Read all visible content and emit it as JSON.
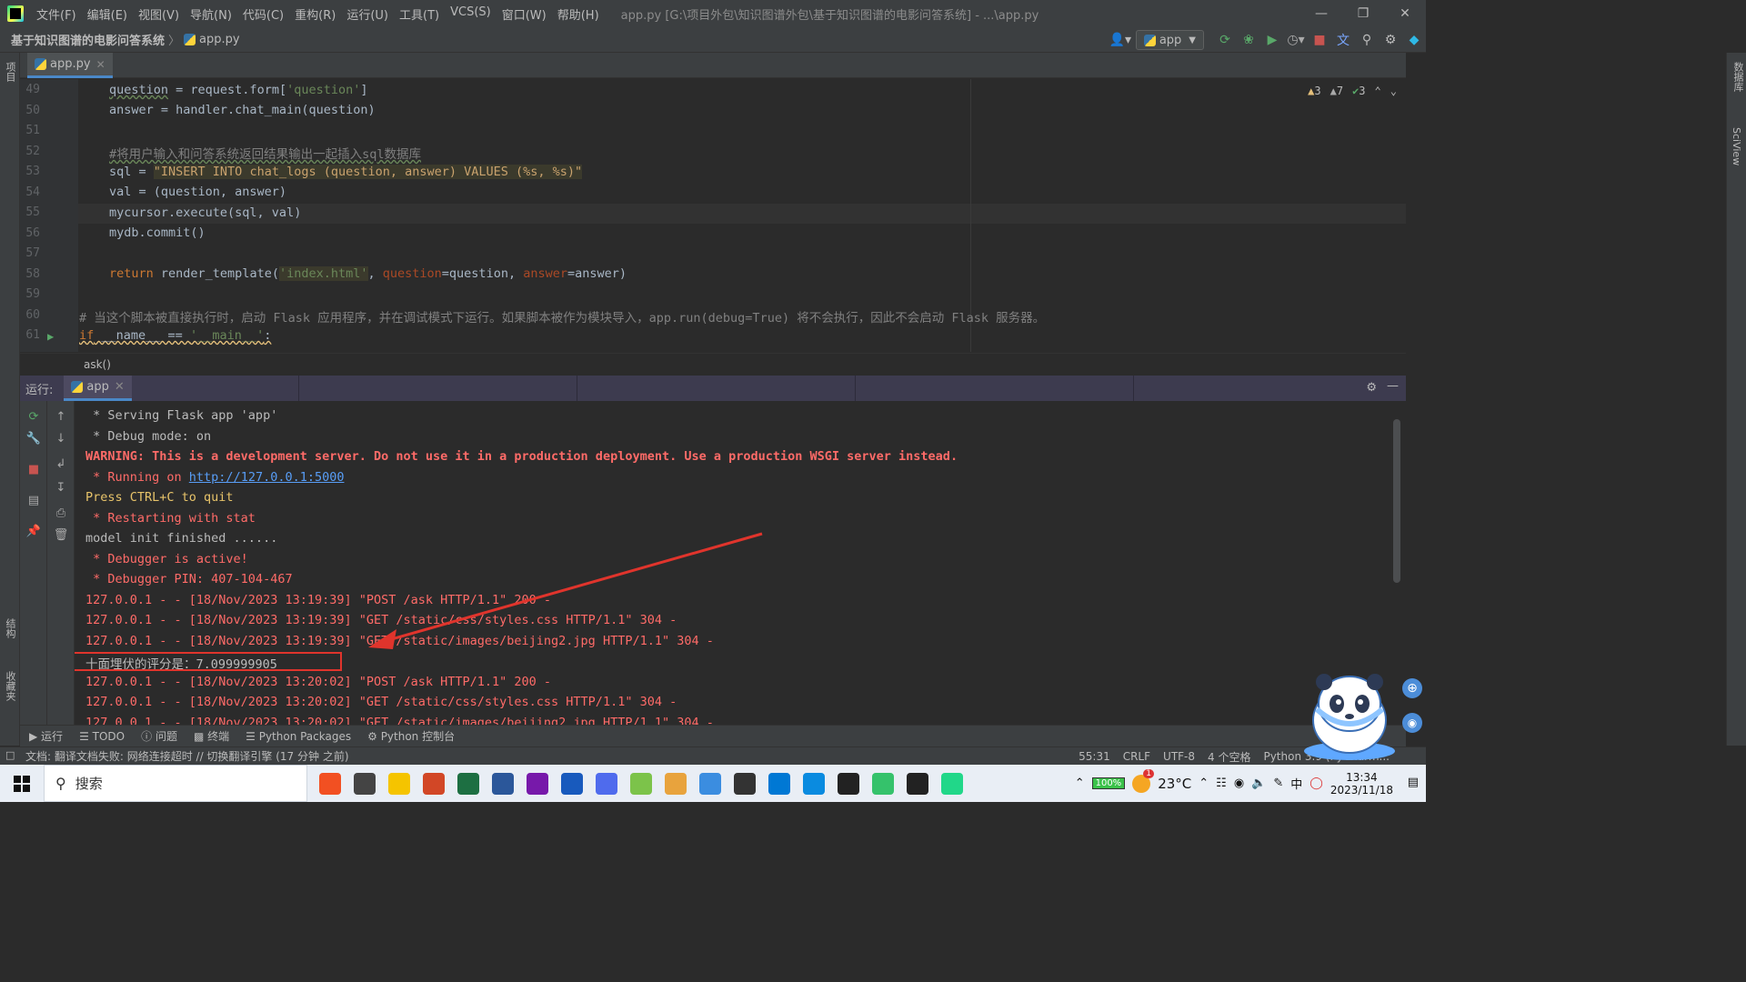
{
  "titlebar": {
    "menus": [
      "文件(F)",
      "编辑(E)",
      "视图(V)",
      "导航(N)",
      "代码(C)",
      "重构(R)",
      "运行(U)",
      "工具(T)",
      "VCS(S)",
      "窗口(W)",
      "帮助(H)"
    ],
    "title": "app.py [G:\\项目外包\\知识图谱外包\\基于知识图谱的电影问答系统] - ...\\app.py"
  },
  "navbar": {
    "project": "基于知识图谱的电影问答系统",
    "file": "app.py",
    "run_config": "app"
  },
  "left_strip": {
    "project_tab": "项目",
    "structure_tab": "结构",
    "favorites_tab": "收藏夹"
  },
  "right_strip": {
    "db_tab": "数据库",
    "sciview_tab": "SciView"
  },
  "editor": {
    "tab": "app.py",
    "inspections": {
      "warnings": "3",
      "weak_warnings": "7",
      "ok": "3"
    },
    "lines": [
      49,
      50,
      51,
      52,
      53,
      54,
      55,
      56,
      57,
      58,
      59,
      60,
      61
    ],
    "code": {
      "l49a": "question",
      "l49b": " = request.form[",
      "l49c": "'question'",
      "l49d": "]",
      "l50": "answer = handler.chat_main(question)",
      "l52": "#将用户输入和问答系统返回结果输出一起插入sql数据库",
      "l53a": "sql = ",
      "l53b": "\"INSERT INTO chat_logs (question, answer) VALUES (%s, %s)\"",
      "l54": "val = (question, answer)",
      "l55": "mycursor.execute(sql, val)",
      "l56": "mydb.commit()",
      "l58a": "return",
      "l58b": " render_template(",
      "l58c": "'index.html'",
      "l58d": ", ",
      "l58e": "question",
      "l58f": "=question, ",
      "l58g": "answer",
      "l58h": "=answer)",
      "l60": "# 当这个脚本被直接执行时，启动 Flask 应用程序，并在调试模式下运行。如果脚本被作为模块导入，app.run(debug=True) 将不会执行，因此不会启动 Flask 服务器。",
      "l61a": "if",
      "l61b": " __name__ == ",
      "l61c": "'__main__'",
      "l61d": ":"
    },
    "breadcrumb": "ask()"
  },
  "run_panel": {
    "label": "运行:",
    "tab": "app",
    "console": [
      {
        "text": " * Serving Flask app 'app'",
        "style": "white"
      },
      {
        "text": " * Debug mode: on",
        "style": "white"
      },
      {
        "text": "WARNING: This is a development server. Do not use it in a production deployment. Use a production WSGI server instead.",
        "style": "warn"
      },
      {
        "text": " * Running on ",
        "style": "red"
      },
      {
        "text": "Press CTRL+C to quit",
        "style": "yellow"
      },
      {
        "text": " * Restarting with stat",
        "style": "red"
      },
      {
        "text": "model init finished ......",
        "style": "white"
      },
      {
        "text": " * Debugger is active!",
        "style": "red"
      },
      {
        "text": " * Debugger PIN: 407-104-467",
        "style": "red"
      },
      {
        "text": "127.0.0.1 - - [18/Nov/2023 13:19:39] \"POST /ask HTTP/1.1\" 200 -",
        "style": "red"
      },
      {
        "text": "127.0.0.1 - - [18/Nov/2023 13:19:39] \"GET /static/css/styles.css HTTP/1.1\" 304 -",
        "style": "red"
      },
      {
        "text": "127.0.0.1 - - [18/Nov/2023 13:19:39] \"GET /static/images/beijing2.jpg HTTP/1.1\" 304 -",
        "style": "red"
      },
      {
        "text": "十面埋伏的评分是：7.099999905",
        "style": "white"
      },
      {
        "text": "127.0.0.1 - - [18/Nov/2023 13:20:02] \"POST /ask HTTP/1.1\" 200 -",
        "style": "red"
      },
      {
        "text": "127.0.0.1 - - [18/Nov/2023 13:20:02] \"GET /static/css/styles.css HTTP/1.1\" 304 -",
        "style": "red"
      },
      {
        "text": "127.0.0.1 - - [18/Nov/2023 13:20:02] \"GET /static/images/beijing2.jpg HTTP/1.1\" 304 -",
        "style": "red"
      }
    ],
    "running_url": "http://127.0.0.1:5000"
  },
  "bottom_tabs": [
    "运行",
    "TODO",
    "问题",
    "终端",
    "Python Packages",
    "Python 控制台"
  ],
  "statusbar": {
    "message": "文档: 翻译文档失败: 网络连接超时 // 切换翻译引擎 (17 分钟 之前)",
    "position": "55:31",
    "line_sep": "CRLF",
    "encoding": "UTF-8",
    "indent": "4 个空格",
    "interpreter": "Python 3.9 (PyCharm..."
  },
  "taskbar": {
    "search": "搜索",
    "battery": "100%",
    "weather": "23°C",
    "ime": "中",
    "time": "13:34",
    "date": "2023/11/18",
    "notification_badge": "1"
  },
  "colors": {
    "accent": "#4a88c7",
    "console_red": "#ff6b68",
    "annotation": "#e0342c"
  }
}
